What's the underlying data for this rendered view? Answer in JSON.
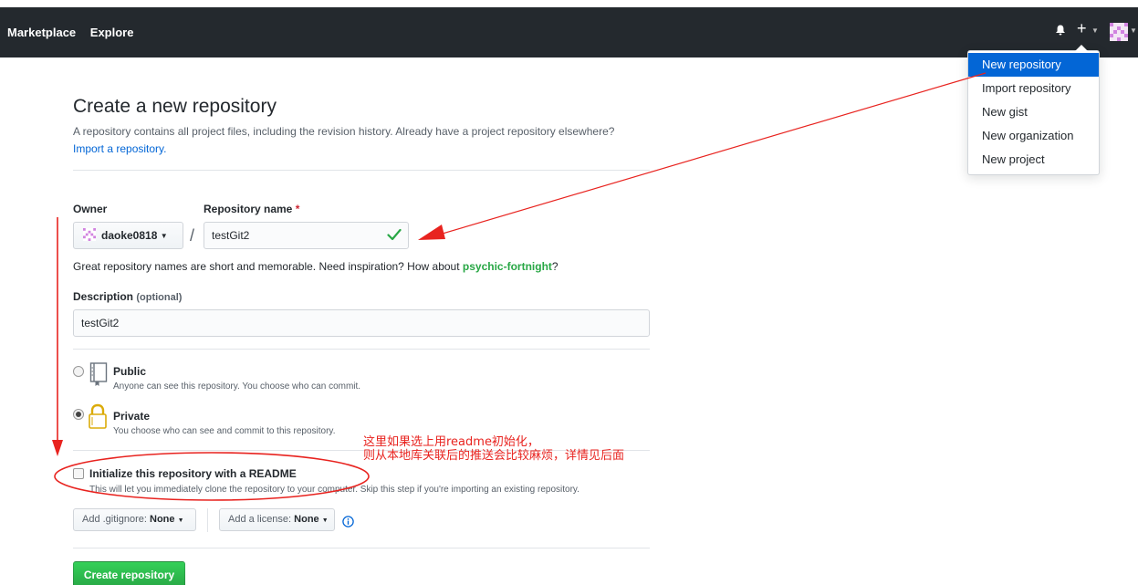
{
  "topbar": {
    "nav": [
      "Marketplace",
      "Explore"
    ]
  },
  "menu": {
    "items": [
      "New repository",
      "Import repository",
      "New gist",
      "New organization",
      "New project"
    ],
    "active_index": 0
  },
  "page": {
    "title": "Create a new repository",
    "subtitle": "A repository contains all project files, including the revision history. Already have a project repository elsewhere?",
    "import_link": "Import a repository."
  },
  "form": {
    "owner_label": "Owner",
    "repo_label": "Repository name",
    "required_mark": "*",
    "owner_value": "daoke0818",
    "slash": "/",
    "repo_value": "testGit2",
    "hint_prefix": "Great repository names are short and memorable. Need inspiration? How about ",
    "hint_suggestion": "psychic-fortnight",
    "hint_suffix": "?",
    "desc_label": "Description",
    "desc_optional": "(optional)",
    "desc_value": "testGit2",
    "public_title": "Public",
    "public_desc": "Anyone can see this repository. You choose who can commit.",
    "private_title": "Private",
    "private_desc": "You choose who can see and commit to this repository.",
    "readme_title": "Initialize this repository with a README",
    "readme_desc": "This will let you immediately clone the repository to your computer. Skip this step if you're importing an existing repository.",
    "gitignore_prefix": "Add .gitignore: ",
    "gitignore_value": "None",
    "license_prefix": "Add a license: ",
    "license_value": "None",
    "create_button": "Create repository"
  },
  "annotation": {
    "line1": "这里如果选上用readme初始化，",
    "line2": "则从本地库关联后的推送会比较麻烦，详情见后面"
  },
  "colors": {
    "header_bg": "#24292e",
    "accent_blue": "#0366d6",
    "success_green": "#28a745",
    "annotation_red": "#e8231f"
  }
}
